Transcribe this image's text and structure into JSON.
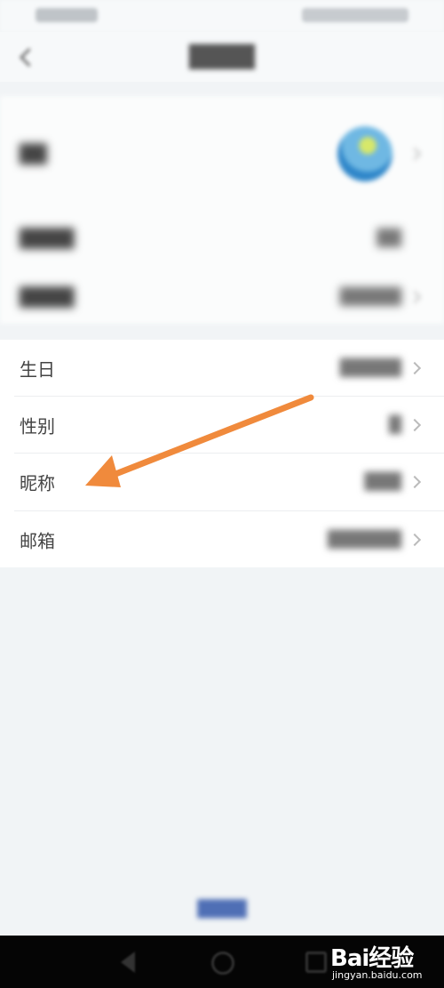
{
  "profile_rows": [
    {
      "label": "生日"
    },
    {
      "label": "性别"
    },
    {
      "label": "昵称"
    },
    {
      "label": "邮箱"
    }
  ],
  "watermark": {
    "logo_text": "Bai经验",
    "url": "jingyan.baidu.com"
  },
  "colors": {
    "arrow": "#f08a3c",
    "background": "#f1f4f6",
    "card": "#ffffff",
    "nav_bar": "#050505"
  },
  "icons": {
    "back": "chevron-left-icon",
    "row_arrow": "chevron-right-icon",
    "annotation": "orange-arrow"
  }
}
